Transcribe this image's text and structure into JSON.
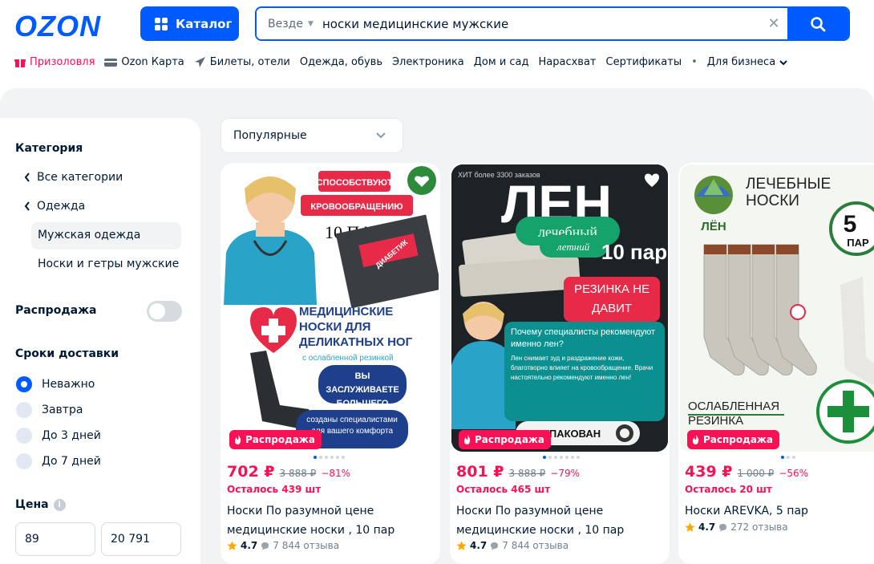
{
  "header": {
    "logo": "OZON",
    "catalog_label": "Каталог",
    "search_scope": "Везде",
    "search_value": "носки медицинские мужские"
  },
  "nav": [
    {
      "label": "Призоловля",
      "icon": "gift-icon",
      "promo": true
    },
    {
      "label": "Ozon Карта",
      "icon": "card-icon"
    },
    {
      "label": "Билеты, отели",
      "icon": "plane-icon"
    },
    {
      "label": "Одежда, обувь"
    },
    {
      "label": "Электроника"
    },
    {
      "label": "Дом и сад"
    },
    {
      "label": "Нарасхват"
    },
    {
      "label": "Сертификаты"
    },
    {
      "label": "Для бизнеса",
      "dropdown": true
    }
  ],
  "sidebar": {
    "category_title": "Категория",
    "categories": [
      {
        "label": "Все категории"
      },
      {
        "label": "Одежда"
      },
      {
        "label": "Мужская одежда",
        "active": true
      },
      {
        "label": "Носки и гетры мужские"
      }
    ],
    "sale_label": "Распродажа",
    "sale_on": false,
    "delivery_title": "Сроки доставки",
    "delivery_options": [
      {
        "label": "Неважно",
        "selected": true
      },
      {
        "label": "Завтра",
        "selected": false
      },
      {
        "label": "До 3 дней",
        "selected": false
      },
      {
        "label": "До 7 дней",
        "selected": false
      }
    ],
    "price_title": "Цена",
    "price_min": "89",
    "price_max": "20 791"
  },
  "sort": {
    "label": "Популярные"
  },
  "products": [
    {
      "badge": "Распродажа",
      "price": "702 ₽",
      "old_price": "3 888 ₽",
      "discount": "−81%",
      "stock": "Осталось 439 шт",
      "title": "Носки По разумной цене медицинские носки , 10 пар",
      "rating": "4.7",
      "reviews": "7 844 отзыва",
      "image": {
        "line1": "СПОСОБСТВУЮТ",
        "line2": "КРОВООБРАЩЕНИЮ",
        "pack": "10 ПАР",
        "headline": "МЕДИЦИНСКИЕ НОСКИ ДЛЯ ДЕЛИКАТНЫХ НОГ",
        "sub": "с ослабленной резинкой",
        "pill": "ВЫ ЗАСЛУЖИВАЕТЕ БОЛЬШЕГО",
        "bottom": "созданы специалистами для вашего комфорта",
        "stamp": "ДИАБЕТИК"
      }
    },
    {
      "badge": "Распродажа",
      "price": "801 ₽",
      "old_price": "3 888 ₽",
      "discount": "−79%",
      "stock": "Осталось 465 шт",
      "title": "Носки По разумной цене медицинские носки , 10 пар",
      "rating": "4.7",
      "reviews": "7 844 отзыва",
      "image": {
        "hit": "ХИТ более 3300 заказов",
        "big": "ЛЕН",
        "line1": "лечебный",
        "line2": "летний",
        "pack": "10 пар",
        "line3": "РЕЗИНКА НЕ ДАВИТ",
        "q": "Почему специалисты рекомендуют именно лен?",
        "txt": "Лен снимает зуд и раздражение кожи, благотворно влияет на кровообращение. Врачи настоятельно рекомендуют именно лен!",
        "bottom": "УПАКОВАН"
      }
    },
    {
      "badge": "Распродажа",
      "price": "439 ₽",
      "old_price": "1 000 ₽",
      "discount": "−56%",
      "stock": "Осталось 20 шт",
      "title": "Носки AREVKA, 5 пар",
      "rating": "4.7",
      "reviews": "272 отзыва",
      "image": {
        "brand": "ЛЁН",
        "head": "ЛЕЧЕБНЫЕ НОСКИ",
        "pack_num": "5",
        "pack_unit": "ПАР",
        "bottom": "ОСЛАБЛЕННАЯ РЕЗИНКА"
      }
    }
  ],
  "colors": {
    "brand": "#005bff",
    "accent": "#f91155",
    "text": "#001a34"
  }
}
